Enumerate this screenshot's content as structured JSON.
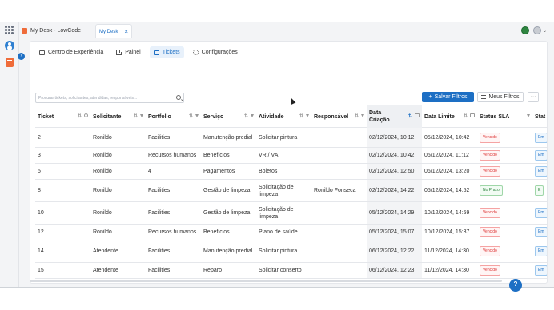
{
  "topbar": {
    "app_title": "My Desk - LowCode",
    "tab_title": "My Desk",
    "close_glyph": "×"
  },
  "rail": {
    "collapse_glyph": "›"
  },
  "nav": {
    "items": [
      {
        "label": "Centro de Experiência",
        "icon": "monitor-icon"
      },
      {
        "label": "Painel",
        "icon": "bar-chart-icon"
      },
      {
        "label": "Tickets",
        "icon": "ticket-icon",
        "active": true
      },
      {
        "label": "Configurações",
        "icon": "gear-icon"
      }
    ]
  },
  "toolbar": {
    "search_placeholder": "Procurar tickets, solicitantes, atendidas, responsáveis...",
    "save_label": "Salvar Filtros",
    "save_glyph": "+",
    "filters_label": "Meus Filtros",
    "more_glyph": "···"
  },
  "table": {
    "columns": [
      "Ticket",
      "Solicitante",
      "Portfolio",
      "Serviço",
      "Atividade",
      "Responsável",
      "Data Criação",
      "Data Limite",
      "Status SLA",
      "Stat"
    ],
    "rows": [
      {
        "ticket": "2",
        "solicitante": "Ronildo",
        "portfolio": "Facilities",
        "servico": "Manutenção predial",
        "atividade": "Solicitar pintura",
        "responsavel": "",
        "criacao": "02/12/2024, 10:12",
        "limite": "05/12/2024, 10:42",
        "sla": "Vencido",
        "status": "Em"
      },
      {
        "ticket": "3",
        "solicitante": "Ronildo",
        "portfolio": "Recursos humanos",
        "servico": "Benefícios",
        "atividade": "VR / VA",
        "responsavel": "",
        "criacao": "02/12/2024, 10:42",
        "limite": "05/12/2024, 11:12",
        "sla": "Vencido",
        "status": "Em"
      },
      {
        "ticket": "5",
        "solicitante": "Ronildo",
        "portfolio": "4",
        "servico": "Pagamentos",
        "atividade": "Boletos",
        "responsavel": "",
        "criacao": "02/12/2024, 12:50",
        "limite": "06/12/2024, 13:20",
        "sla": "Vencido",
        "status": "Em"
      },
      {
        "ticket": "8",
        "solicitante": "Ronildo",
        "portfolio": "Facilities",
        "servico": "Gestão de limpeza",
        "atividade": "Solicitação de limpeza",
        "responsavel": "Ronildo Fonseca",
        "criacao": "02/12/2024, 14:22",
        "limite": "05/12/2024, 14:52",
        "sla": "No Prazo",
        "status": "E"
      },
      {
        "ticket": "10",
        "solicitante": "Ronildo",
        "portfolio": "Facilities",
        "servico": "Gestão de limpeza",
        "atividade": "Solicitação de limpeza",
        "responsavel": "",
        "criacao": "05/12/2024, 14:29",
        "limite": "10/12/2024, 14:59",
        "sla": "Vencido",
        "status": "Em"
      },
      {
        "ticket": "12",
        "solicitante": "Ronildo",
        "portfolio": "Recursos humanos",
        "servico": "Benefícios",
        "atividade": "Plano de saúde",
        "responsavel": "",
        "criacao": "05/12/2024, 15:07",
        "limite": "10/12/2024, 15:37",
        "sla": "Vencido",
        "status": "Em"
      },
      {
        "ticket": "14",
        "solicitante": "Atendente",
        "portfolio": "Facilities",
        "servico": "Manutenção predial",
        "atividade": "Solicitar pintura",
        "responsavel": "",
        "criacao": "06/12/2024, 12:22",
        "limite": "11/12/2024, 14:30",
        "sla": "Vencido",
        "status": "Em"
      },
      {
        "ticket": "15",
        "solicitante": "Atendente",
        "portfolio": "Facilities",
        "servico": "Reparo",
        "atividade": "Solicitar conserto",
        "responsavel": "",
        "criacao": "06/12/2024, 12:23",
        "limite": "11/12/2024, 14:30",
        "sla": "Vencido",
        "status": "Em"
      }
    ]
  },
  "colors": {
    "accent": "#1d6fc4",
    "overdue": "#d33333",
    "on_time": "#2e8540",
    "brand_orange": "#ef6c3a"
  }
}
